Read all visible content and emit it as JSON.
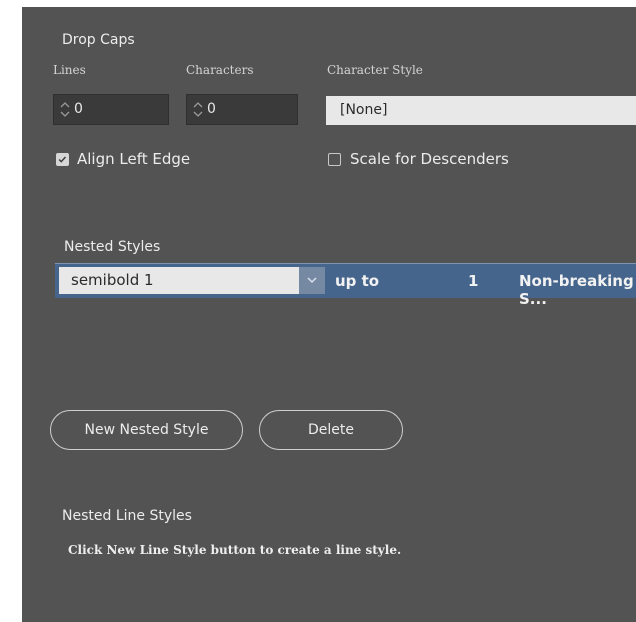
{
  "drop_caps": {
    "title": "Drop Caps",
    "lines_label": "Lines",
    "characters_label": "Characters",
    "char_style_label": "Character Style",
    "lines_value": "0",
    "characters_value": "0",
    "char_style_value": "[None]",
    "align_left_edge": {
      "label": "Align Left Edge",
      "checked": true
    },
    "scale_descenders": {
      "label": "Scale for Descenders",
      "checked": false
    }
  },
  "nested_styles": {
    "title": "Nested Styles",
    "row": {
      "style": "semibold 1",
      "mode": "up to",
      "count": "1",
      "delimiter": "Non-breaking S..."
    },
    "new_button": "New Nested Style",
    "delete_button": "Delete"
  },
  "nested_line_styles": {
    "title": "Nested Line Styles",
    "hint": "Click New Line Style button to create a line style."
  },
  "colors": {
    "panel_bg": "#535353",
    "row_highlight": "#45658c"
  }
}
